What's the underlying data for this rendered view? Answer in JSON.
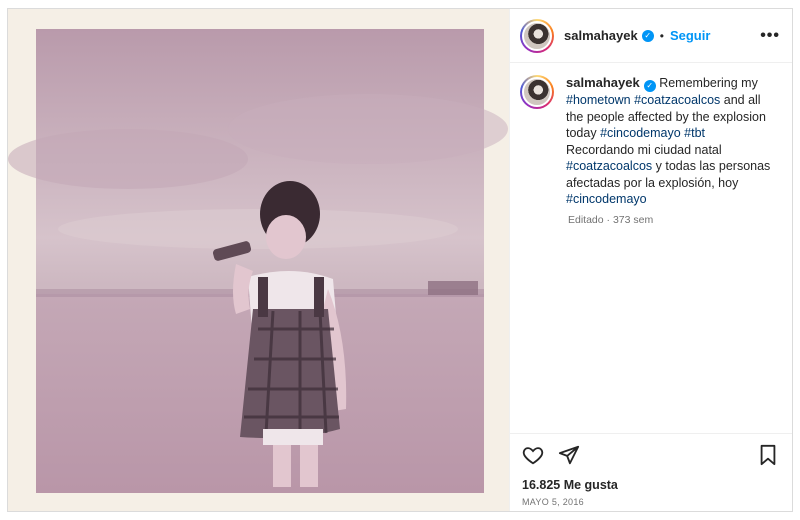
{
  "post": {
    "username": "salmahayek",
    "dot": "•",
    "follow_label": "Seguir",
    "more_label": "•••"
  },
  "caption": {
    "username": "salmahayek",
    "parts": [
      {
        "text": " Remembering my ",
        "tag": false
      },
      {
        "text": "#hometown",
        "tag": true
      },
      {
        "text": " ",
        "tag": false
      },
      {
        "text": "#coatzacoalcos",
        "tag": true
      },
      {
        "text": " and all the people affected by the explosion today ",
        "tag": false
      },
      {
        "text": "#cincodemayo",
        "tag": true
      },
      {
        "text": " ",
        "tag": false
      },
      {
        "text": "#tbt",
        "tag": true
      },
      {
        "text": " Recordando mi ciudad natal ",
        "tag": false
      },
      {
        "text": "#coatzacoalcos",
        "tag": true
      },
      {
        "text": " y todas las personas afectadas por la explosión, hoy ",
        "tag": false
      },
      {
        "text": "#cincodemayo",
        "tag": true
      }
    ],
    "meta": "Editado · 373 sem"
  },
  "footer": {
    "likes": "16.825 Me gusta",
    "date": "MAYO 5, 2016"
  },
  "icons": {
    "like": "heart-icon",
    "share": "paper-plane-icon",
    "save": "bookmark-icon",
    "verified": "verified-badge-icon"
  },
  "colors": {
    "accent": "#0095f6",
    "hashtag": "#00376b",
    "muted": "#737373",
    "photo_tone": "#c7a9b5"
  }
}
